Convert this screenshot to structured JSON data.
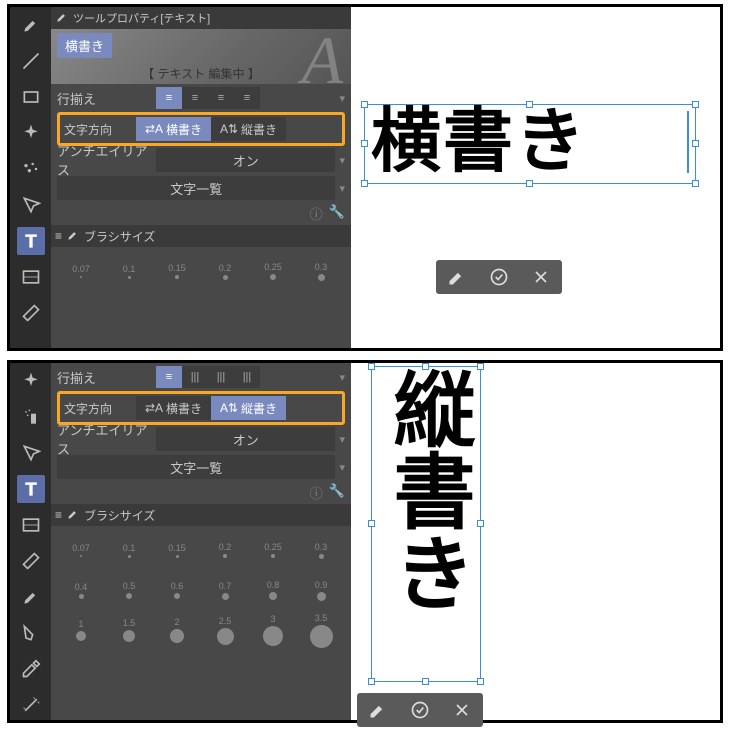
{
  "panel": {
    "title": "ツールプロパティ[テキスト]",
    "bannerTag": "横書き",
    "bannerStatus": "【 テキスト 編集中 】",
    "lineAlignLabel": "行揃え",
    "textDirLabel": "文字方向",
    "dir_h": "横書き",
    "dir_v": "縦書き",
    "antiAliasLabel": "アンチエイリアス",
    "antiAliasValue": "オン",
    "charListLabel": "文字一覧",
    "brushSizeLabel": "ブラシサイズ"
  },
  "brushRows": {
    "top1": [
      "0.07",
      "0.1",
      "0.15",
      "0.2",
      "0.25",
      "0.3"
    ],
    "ext": [
      [
        "0.07",
        "0.1",
        "0.15",
        "0.2",
        "0.25",
        "0.3"
      ],
      [
        "0.4",
        "0.5",
        "0.6",
        "0.7",
        "0.8",
        "0.9"
      ],
      [
        "1",
        "1.5",
        "2",
        "2.5",
        "3",
        "3.5"
      ]
    ]
  },
  "canvas": {
    "textH": "横書き",
    "textV": "縦書き"
  }
}
